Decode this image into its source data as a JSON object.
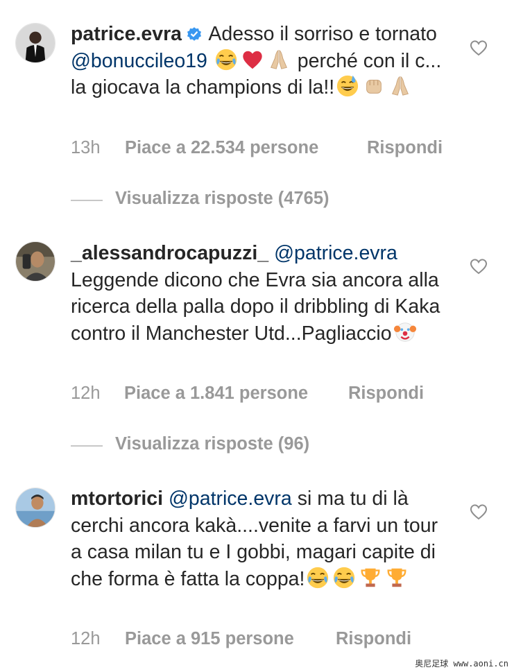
{
  "comments": [
    {
      "username": "patrice.evra",
      "verified": true,
      "text_1": "Adesso il sorriso e tornato",
      "mention": "@bonuccileo19",
      "text_2": "perché con il c... la giocava la champions di la!!",
      "time": "13h",
      "likes": "Piace a 22.534 persone",
      "reply": "Rispondi",
      "view_replies": "Visualizza risposte (4765)",
      "emojis": [
        "laughing-tears-emoji",
        "red-heart-emoji",
        "folded-hands-emoji",
        "grinning-sweat-emoji",
        "fist-bump-emoji",
        "folded-hands-emoji"
      ]
    },
    {
      "username": "_alessandrocapuzzi_",
      "mention": "@patrice.evra",
      "text_1": "Leggende dicono che Evra sia ancora alla ricerca della palla dopo il dribbling di Kaka contro il Manchester Utd...Pagliaccio",
      "time": "12h",
      "likes": "Piace a 1.841 persone",
      "reply": "Rispondi",
      "view_replies": "Visualizza risposte (96)",
      "emojis": [
        "clown-emoji"
      ]
    },
    {
      "username": "mtortorici",
      "mention": "@patrice.evra",
      "text_1": "si ma tu di là cerchi ancora kakà....venite a farvi un tour a casa milan  tu e I gobbi, magari capite di che forma è fatta la coppa!",
      "time": "12h",
      "likes": "Piace a 915 persone",
      "reply": "Rispondi",
      "emojis": [
        "laughing-tears-emoji",
        "laughing-tears-emoji",
        "trophy-emoji",
        "trophy-emoji"
      ]
    }
  ],
  "watermark": "奥尼足球 www.aoni.cn",
  "colors": {
    "text": "#262626",
    "mention": "#003569",
    "muted": "#999999",
    "verified": "#3897f0"
  }
}
